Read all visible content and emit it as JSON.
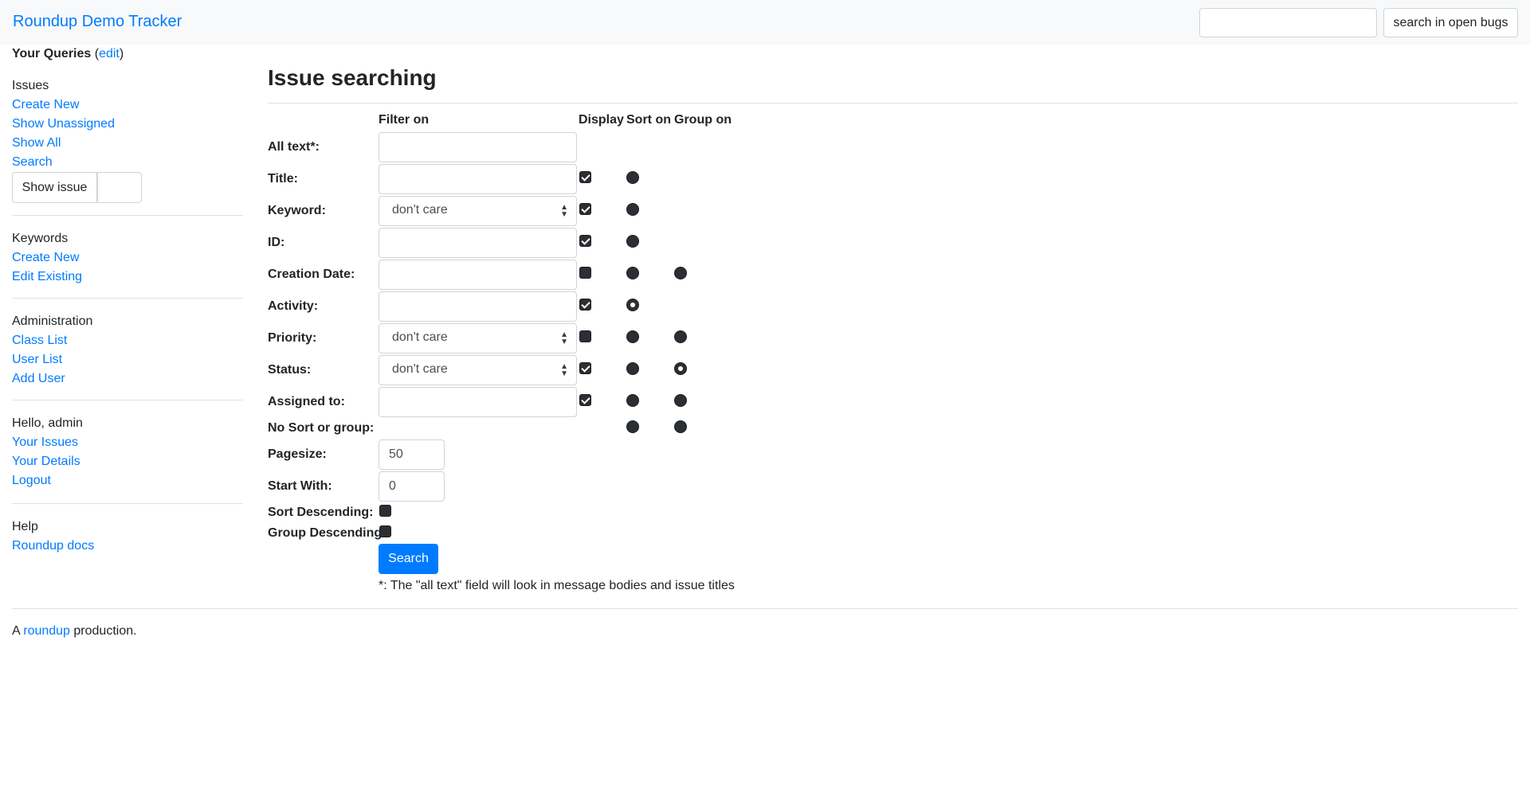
{
  "navbar": {
    "brand": "Roundup Demo Tracker",
    "search_placeholder": "",
    "search_button": "search in open bugs"
  },
  "sidebar": {
    "your_queries": "Your Queries",
    "open_paren": " (",
    "edit_link": "edit",
    "close_paren": ")",
    "issues": {
      "heading": "Issues",
      "create_new": "Create New",
      "show_unassigned": "Show Unassigned",
      "show_all": "Show All",
      "search": "Search",
      "show_issue_button": "Show issue"
    },
    "keywords": {
      "heading": "Keywords",
      "create_new": "Create New",
      "edit_existing": "Edit Existing"
    },
    "administration": {
      "heading": "Administration",
      "class_list": "Class List",
      "user_list": "User List",
      "add_user": "Add User"
    },
    "user": {
      "greeting": "Hello, admin",
      "your_issues": "Your Issues",
      "your_details": "Your Details",
      "logout": "Logout"
    },
    "help": {
      "heading": "Help",
      "roundup_docs": "Roundup docs"
    }
  },
  "main": {
    "title": "Issue searching",
    "columns": {
      "filter_on": "Filter on",
      "display": "Display",
      "sort_on": "Sort on",
      "group_on": "Group on"
    },
    "rows": {
      "all_text": {
        "label": "All text*:",
        "value": ""
      },
      "title": {
        "label": "Title:",
        "value": "",
        "display": true,
        "sort_selected": false
      },
      "keyword": {
        "label": "Keyword:",
        "select": "don't care",
        "display": true,
        "sort_selected": false
      },
      "id": {
        "label": "ID:",
        "value": "",
        "display": true,
        "sort_selected": false
      },
      "creation": {
        "label": "Creation Date:",
        "value": "",
        "display": false,
        "sort_selected": false,
        "group_selected": false
      },
      "activity": {
        "label": "Activity:",
        "value": "",
        "display": true,
        "sort_selected": true
      },
      "priority": {
        "label": "Priority:",
        "select": "don't care",
        "display": false,
        "sort_selected": false,
        "group_selected": false
      },
      "status": {
        "label": "Status:",
        "select": "don't care",
        "display": true,
        "sort_selected": false,
        "group_selected": true
      },
      "assignedto": {
        "label": "Assigned to:",
        "value": "",
        "display": true,
        "sort_selected": false,
        "group_selected": false
      },
      "nosort": {
        "label": "No Sort or group:",
        "sort_selected": false,
        "group_selected": false
      }
    },
    "pagesize": {
      "label": "Pagesize:",
      "value": "50"
    },
    "startwith": {
      "label": "Start With:",
      "value": "0"
    },
    "sort_descending": {
      "label": "Sort Descending:",
      "checked": false
    },
    "group_descending": {
      "label": "Group Descending:",
      "checked": false
    },
    "search_button": "Search",
    "footnote": "*: The \"all text\" field will look in message bodies and issue titles"
  },
  "footer": {
    "prefix": "A ",
    "link": "roundup",
    "suffix": " production."
  }
}
